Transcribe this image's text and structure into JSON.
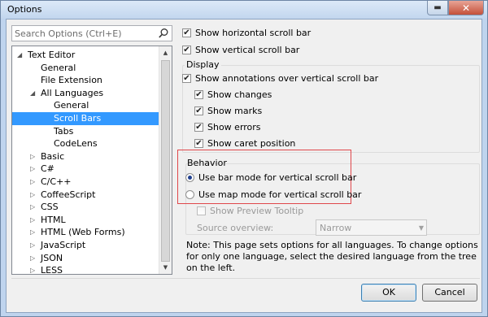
{
  "window": {
    "title": "Options"
  },
  "titlebar": {
    "minimize_glyph": "▬",
    "close_glyph": "✕"
  },
  "search": {
    "placeholder": "Search Options (Ctrl+E)"
  },
  "tree": {
    "items": [
      {
        "label": "Text Editor",
        "expanded": true,
        "selected": false
      },
      {
        "label": "General",
        "selected": false
      },
      {
        "label": "File Extension",
        "selected": false
      },
      {
        "label": "All Languages",
        "expanded": true,
        "selected": false
      },
      {
        "label": "General",
        "selected": false
      },
      {
        "label": "Scroll Bars",
        "selected": true
      },
      {
        "label": "Tabs",
        "selected": false
      },
      {
        "label": "CodeLens",
        "selected": false
      },
      {
        "label": "Basic",
        "expanded": false,
        "selected": false
      },
      {
        "label": "C#",
        "expanded": false,
        "selected": false
      },
      {
        "label": "C/C++",
        "expanded": false,
        "selected": false
      },
      {
        "label": "CoffeeScript",
        "expanded": false,
        "selected": false
      },
      {
        "label": "CSS",
        "expanded": false,
        "selected": false
      },
      {
        "label": "HTML",
        "expanded": false,
        "selected": false
      },
      {
        "label": "HTML (Web Forms)",
        "expanded": false,
        "selected": false
      },
      {
        "label": "JavaScript",
        "expanded": false,
        "selected": false
      },
      {
        "label": "JSON",
        "expanded": false,
        "selected": false
      },
      {
        "label": "LESS",
        "expanded": false,
        "selected": false
      }
    ],
    "expanded_glyph": "◢",
    "collapsed_glyph": "▷",
    "scroll_up_glyph": "▲",
    "scroll_down_glyph": "▼"
  },
  "options": {
    "show_horizontal_scroll_bar": {
      "label": "Show horizontal scroll bar",
      "checked": true
    },
    "show_vertical_scroll_bar": {
      "label": "Show vertical scroll bar",
      "checked": true
    },
    "display_group_title": "Display",
    "show_annotations": {
      "label": "Show annotations over vertical scroll bar",
      "checked": true
    },
    "show_changes": {
      "label": "Show changes",
      "checked": true
    },
    "show_marks": {
      "label": "Show marks",
      "checked": true
    },
    "show_errors": {
      "label": "Show errors",
      "checked": true
    },
    "show_caret_position": {
      "label": "Show caret position",
      "checked": true
    },
    "behavior_group_title": "Behavior",
    "bar_mode": {
      "label": "Use bar mode for vertical scroll bar",
      "selected": true
    },
    "map_mode": {
      "label": "Use map mode for vertical scroll bar",
      "selected": false
    },
    "show_preview_tooltip": {
      "label": "Show Preview Tooltip",
      "checked": false,
      "disabled": true
    },
    "source_overview": {
      "label": "Source overview:",
      "value": "Narrow",
      "disabled": true
    }
  },
  "note": "Note: This page sets options for all languages. To change options for only one language, select the desired language from the tree on the left.",
  "buttons": {
    "ok": "OK",
    "cancel": "Cancel"
  },
  "check_glyph": "✔",
  "colors": {
    "selection": "#3399ff",
    "highlight_box": "#e0474b"
  }
}
